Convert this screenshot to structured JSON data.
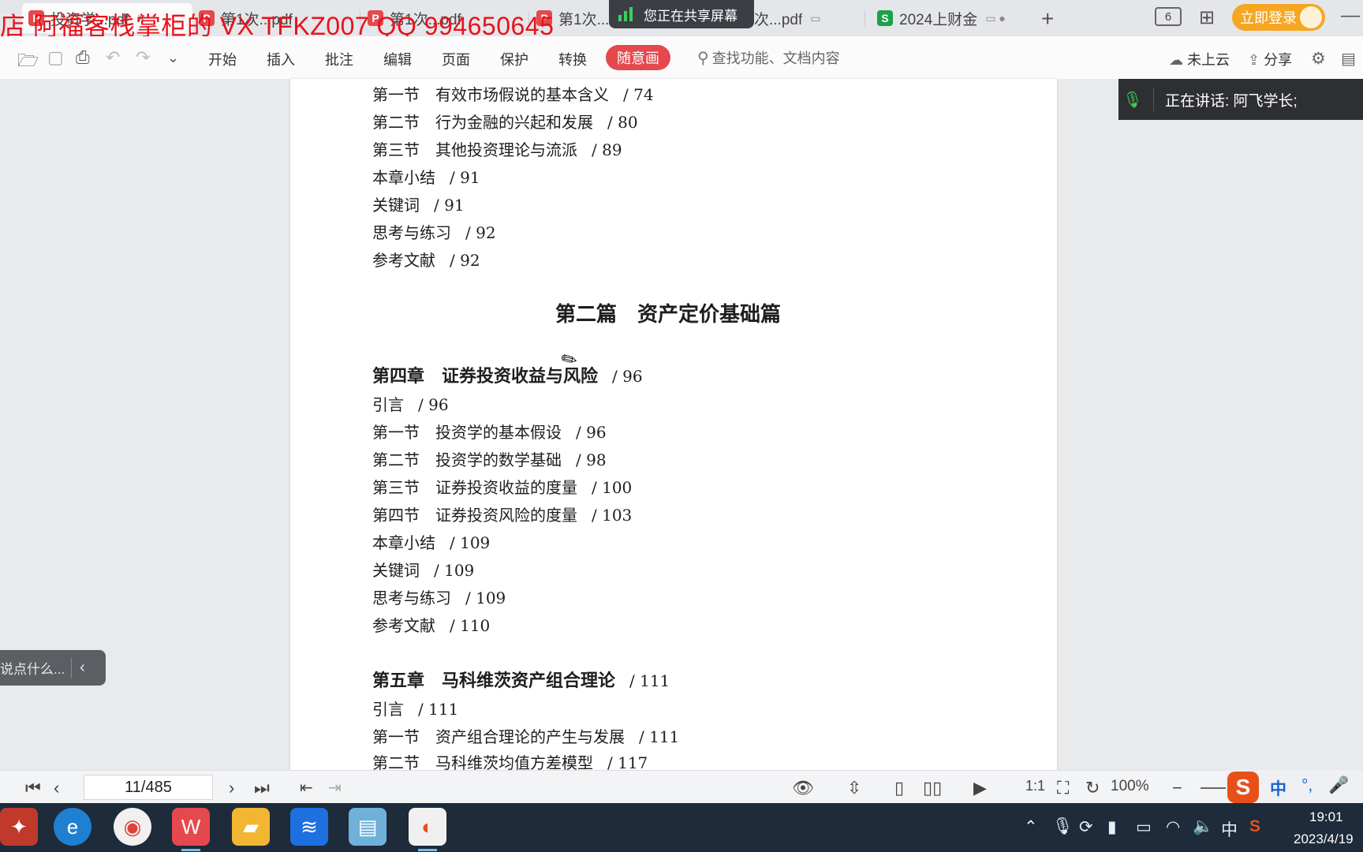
{
  "watermark": "店 阿福客栈掌柜的  VX TFKZ007 QQ 994650645",
  "tabs": [
    {
      "label": "投资学...pdf",
      "type": "pdf",
      "active": true
    },
    {
      "label": "第1次...pdf",
      "type": "pdf",
      "active": false
    },
    {
      "label": "第1次...pdf",
      "type": "pdf",
      "active": false
    },
    {
      "label": "第1次...",
      "type": "pdf",
      "active": false
    },
    {
      "label": "次...pdf",
      "type": "pdf",
      "active": false
    },
    {
      "label": "2024上财金",
      "type": "xls",
      "active": false
    }
  ],
  "share_banner": "您正在共享屏幕",
  "tab_count": "6",
  "login_label": "立即登录",
  "menu": [
    "开始",
    "插入",
    "批注",
    "编辑",
    "页面",
    "保护",
    "转换"
  ],
  "menu_highlight": "随意画",
  "search_placeholder": "查找功能、文档内容",
  "cloud_label": "未上云",
  "share_label": "分享",
  "speaking": "正在讲话: 阿飞学长;",
  "chat_placeholder": "说点什么...",
  "toc": [
    {
      "label": "第一节　有效市场假说的基本含义",
      "page": "/ 74"
    },
    {
      "label": "第二节　行为金融的兴起和发展",
      "page": "/ 80"
    },
    {
      "label": "第三节　其他投资理论与流派",
      "page": "/ 89"
    },
    {
      "label": "本章小结",
      "page": "/ 91"
    },
    {
      "label": "关键词",
      "page": "/ 91"
    },
    {
      "label": "思考与练习",
      "page": "/ 92"
    },
    {
      "label": "参考文献",
      "page": "/ 92"
    }
  ],
  "part_title": "第二篇　资产定价基础篇",
  "chapter4": {
    "title": "第四章　证券投资收益与风险",
    "page": "/ 96"
  },
  "chapter4_items": [
    {
      "label": "引言",
      "page": "/ 96"
    },
    {
      "label": "第一节　投资学的基本假设",
      "page": "/ 96"
    },
    {
      "label": "第二节　投资学的数学基础",
      "page": "/ 98"
    },
    {
      "label": "第三节　证券投资收益的度量",
      "page": "/ 100"
    },
    {
      "label": "第四节　证券投资风险的度量",
      "page": "/ 103"
    },
    {
      "label": "本章小结",
      "page": "/ 109"
    },
    {
      "label": "关键词",
      "page": "/ 109"
    },
    {
      "label": "思考与练习",
      "page": "/ 109"
    },
    {
      "label": "参考文献",
      "page": "/ 110"
    }
  ],
  "chapter5": {
    "title": "第五章　马科维茨资产组合理论",
    "page": "/ 111"
  },
  "chapter5_items": [
    {
      "label": "引言",
      "page": "/ 111"
    },
    {
      "label": "第一节　资产组合理论的产生与发展",
      "page": "/ 111"
    },
    {
      "label": "第二节　马科维茨均值方差模型",
      "page": "/ 117"
    }
  ],
  "page_indicator": "11/485",
  "zoom": "100%",
  "ime_label": "中",
  "clock_time": "19:01",
  "clock_date": "2023/4/19",
  "colors": {
    "accent": "#e5484d",
    "watermark": "#e8121a",
    "login": "#f5a623",
    "taskbar": "#1d2b3a"
  }
}
